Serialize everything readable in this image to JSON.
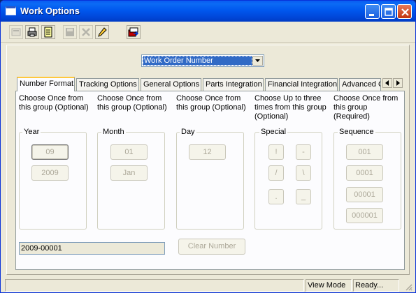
{
  "window": {
    "title": "Work Options"
  },
  "toolbar": {
    "tools": [
      {
        "name": "new-icon"
      },
      {
        "name": "print-icon"
      },
      {
        "name": "report-icon"
      },
      {
        "name": "save-icon"
      },
      {
        "name": "delete-icon"
      },
      {
        "name": "edit-icon"
      },
      {
        "name": "exit-icon"
      }
    ]
  },
  "selector": {
    "value": "Work Order Number"
  },
  "tabs": [
    {
      "label": "Number Format",
      "active": true
    },
    {
      "label": "Tracking Options"
    },
    {
      "label": "General Options"
    },
    {
      "label": "Parts Integration"
    },
    {
      "label": "Financial Integration"
    },
    {
      "label": "Advanced O"
    }
  ],
  "groups": {
    "year": {
      "hint": "Choose Once from this group (Optional)",
      "legend": "Year",
      "buttons": [
        "09",
        "2009"
      ]
    },
    "month": {
      "hint": "Choose Once from this group (Optional)",
      "legend": "Month",
      "buttons": [
        "01",
        "Jan"
      ]
    },
    "day": {
      "hint": "Choose Once from this group (Optional)",
      "legend": "Day",
      "buttons": [
        "12"
      ]
    },
    "special": {
      "hint": "Choose Up to three times from this group (Optional)",
      "legend": "Special",
      "buttons": [
        "!",
        "-",
        "/",
        "\\",
        ".",
        "_"
      ]
    },
    "sequence": {
      "hint": "Choose Once from this group (Required)",
      "legend": "Sequence",
      "buttons": [
        "001",
        "0001",
        "00001",
        "000001"
      ]
    }
  },
  "number_preview": "2009-00001",
  "clear_label": "Clear Number",
  "status": {
    "mode": "View Mode",
    "state": "Ready..."
  }
}
